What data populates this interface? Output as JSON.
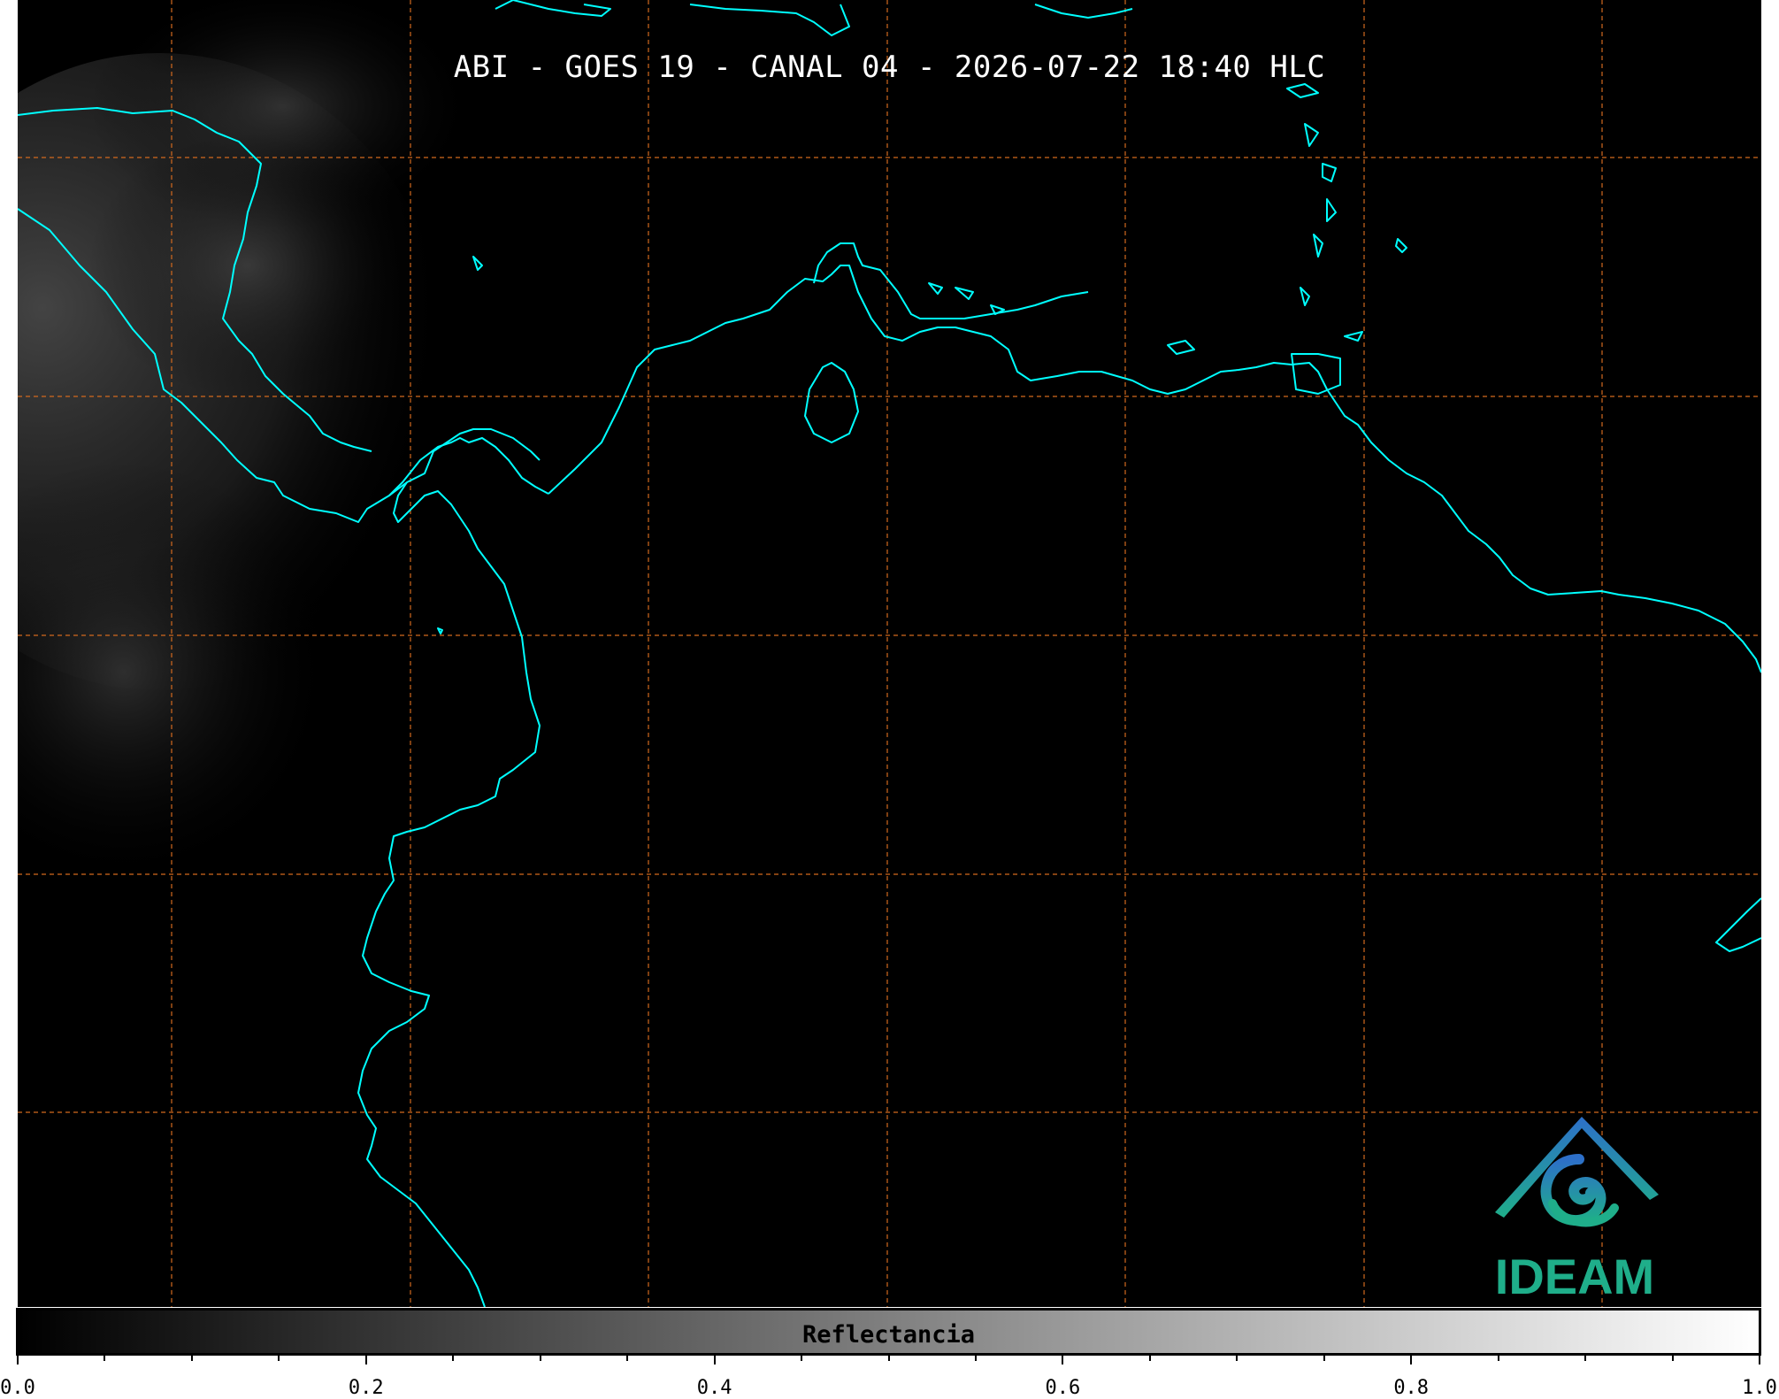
{
  "title": "ABI - GOES 19 - CANAL 04 - 2026-07-22 18:40 HLC",
  "map": {
    "coastline_color": "#00ffff",
    "grid_color": "#d2691e",
    "background_color": "#000000",
    "grid_style": "dashed"
  },
  "logo": {
    "text": "IDEAM",
    "text_color": "#1fae8a",
    "icon": "ideam-mountain-spiral-logo"
  },
  "colorbar": {
    "label": "Reflectancia",
    "range": [
      0.0,
      1.0
    ],
    "colors": [
      "#000000",
      "#ffffff"
    ],
    "tick_labels": [
      "0.0",
      "0.2",
      "0.4",
      "0.6",
      "0.8",
      "1.0"
    ],
    "tick_values": [
      0.0,
      0.2,
      0.4,
      0.6,
      0.8,
      1.0
    ],
    "minor_ticks": 4
  }
}
